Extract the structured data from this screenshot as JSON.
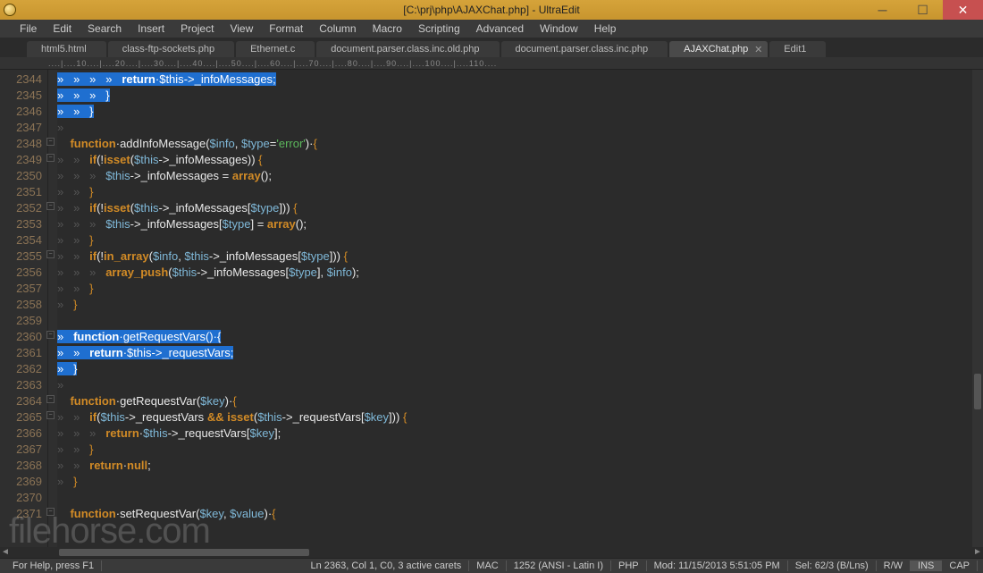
{
  "title": "[C:\\prj\\php\\AJAXChat.php] - UltraEdit",
  "menus": [
    "File",
    "Edit",
    "Search",
    "Insert",
    "Project",
    "View",
    "Format",
    "Column",
    "Macro",
    "Scripting",
    "Advanced",
    "Window",
    "Help"
  ],
  "tabs": [
    {
      "label": "html5.html",
      "active": false
    },
    {
      "label": "class-ftp-sockets.php",
      "active": false
    },
    {
      "label": "Ethernet.c",
      "active": false
    },
    {
      "label": "document.parser.class.inc.old.php",
      "active": false
    },
    {
      "label": "document.parser.class.inc.php",
      "active": false
    },
    {
      "label": "AJAXChat.php",
      "active": true
    },
    {
      "label": "Edit1",
      "active": false
    }
  ],
  "ruler": "....|....10....|....20....|....30....|....40....|....50....|....60....|....70....|....80....|....90....|....100....|....110....",
  "first_line": 2344,
  "lines": [
    {
      "sel": true,
      "seg": [
        [
          "tab",
          "»   "
        ],
        [
          "tab",
          "»   "
        ],
        [
          "tab",
          "»   "
        ],
        [
          "tab",
          "»   "
        ],
        [
          "kw",
          "return"
        ],
        [
          "op",
          "·"
        ],
        [
          "var",
          "$this"
        ],
        [
          "op",
          "->"
        ],
        [
          "fn",
          "_infoMessages"
        ],
        [
          "op",
          ";"
        ]
      ]
    },
    {
      "sel": true,
      "seg": [
        [
          "tab",
          "»   "
        ],
        [
          "tab",
          "»   "
        ],
        [
          "tab",
          "»   "
        ],
        [
          "br",
          "}"
        ]
      ]
    },
    {
      "sel": true,
      "seg": [
        [
          "tab",
          "»   "
        ],
        [
          "tab",
          "»   "
        ],
        [
          "br",
          "}"
        ]
      ]
    },
    {
      "sel": false,
      "seg": [
        [
          "tab",
          "»"
        ]
      ]
    },
    {
      "sel": false,
      "seg": [
        [
          "ws",
          "    "
        ],
        [
          "kw",
          "function"
        ],
        [
          "op",
          "·"
        ],
        [
          "fn",
          "addInfoMessage"
        ],
        [
          "op",
          "("
        ],
        [
          "var",
          "$info"
        ],
        [
          "op",
          ", "
        ],
        [
          "var",
          "$type"
        ],
        [
          "op",
          "="
        ],
        [
          "str",
          "'error'"
        ],
        [
          "op",
          ")·"
        ],
        [
          "br",
          "{"
        ]
      ]
    },
    {
      "sel": false,
      "seg": [
        [
          "tab",
          "»   »   "
        ],
        [
          "kw",
          "if"
        ],
        [
          "op",
          "(!"
        ],
        [
          "kw",
          "isset"
        ],
        [
          "op",
          "("
        ],
        [
          "var",
          "$this"
        ],
        [
          "op",
          "->"
        ],
        [
          "fn",
          "_infoMessages"
        ],
        [
          "op",
          ")) "
        ],
        [
          "br",
          "{"
        ]
      ]
    },
    {
      "sel": false,
      "seg": [
        [
          "tab",
          "»   »   »   "
        ],
        [
          "var",
          "$this"
        ],
        [
          "op",
          "->"
        ],
        [
          "fn",
          "_infoMessages"
        ],
        [
          "op",
          " = "
        ],
        [
          "kw",
          "array"
        ],
        [
          "op",
          "();"
        ]
      ]
    },
    {
      "sel": false,
      "seg": [
        [
          "tab",
          "»   »   "
        ],
        [
          "br",
          "}"
        ]
      ]
    },
    {
      "sel": false,
      "seg": [
        [
          "tab",
          "»   »   "
        ],
        [
          "kw",
          "if"
        ],
        [
          "op",
          "(!"
        ],
        [
          "kw",
          "isset"
        ],
        [
          "op",
          "("
        ],
        [
          "var",
          "$this"
        ],
        [
          "op",
          "->"
        ],
        [
          "fn",
          "_infoMessages"
        ],
        [
          "op",
          "["
        ],
        [
          "var",
          "$type"
        ],
        [
          "op",
          "])) "
        ],
        [
          "br",
          "{"
        ]
      ]
    },
    {
      "sel": false,
      "seg": [
        [
          "tab",
          "»   »   »   "
        ],
        [
          "var",
          "$this"
        ],
        [
          "op",
          "->"
        ],
        [
          "fn",
          "_infoMessages"
        ],
        [
          "op",
          "["
        ],
        [
          "var",
          "$type"
        ],
        [
          "op",
          "] = "
        ],
        [
          "kw",
          "array"
        ],
        [
          "op",
          "();"
        ]
      ]
    },
    {
      "sel": false,
      "seg": [
        [
          "tab",
          "»   »   "
        ],
        [
          "br",
          "}"
        ]
      ]
    },
    {
      "sel": false,
      "seg": [
        [
          "tab",
          "»   »   "
        ],
        [
          "kw",
          "if"
        ],
        [
          "op",
          "(!"
        ],
        [
          "kw",
          "in_array"
        ],
        [
          "op",
          "("
        ],
        [
          "var",
          "$info"
        ],
        [
          "op",
          ", "
        ],
        [
          "var",
          "$this"
        ],
        [
          "op",
          "->"
        ],
        [
          "fn",
          "_infoMessages"
        ],
        [
          "op",
          "["
        ],
        [
          "var",
          "$type"
        ],
        [
          "op",
          "])) "
        ],
        [
          "br",
          "{"
        ]
      ]
    },
    {
      "sel": false,
      "seg": [
        [
          "tab",
          "»   »   »   "
        ],
        [
          "kw",
          "array_push"
        ],
        [
          "op",
          "("
        ],
        [
          "var",
          "$this"
        ],
        [
          "op",
          "->"
        ],
        [
          "fn",
          "_infoMessages"
        ],
        [
          "op",
          "["
        ],
        [
          "var",
          "$type"
        ],
        [
          "op",
          "], "
        ],
        [
          "var",
          "$info"
        ],
        [
          "op",
          ");"
        ]
      ]
    },
    {
      "sel": false,
      "seg": [
        [
          "tab",
          "»   »   "
        ],
        [
          "br",
          "}"
        ]
      ]
    },
    {
      "sel": false,
      "seg": [
        [
          "tab",
          "»   "
        ],
        [
          "br",
          "}"
        ]
      ]
    },
    {
      "sel": false,
      "seg": [
        [
          "ws",
          " "
        ]
      ]
    },
    {
      "sel": true,
      "seg": [
        [
          "tab",
          "»   "
        ],
        [
          "kw",
          "function"
        ],
        [
          "op",
          "·"
        ],
        [
          "fn",
          "getRequestVars"
        ],
        [
          "op",
          "()·"
        ],
        [
          "br",
          "{"
        ]
      ]
    },
    {
      "sel": true,
      "seg": [
        [
          "tab",
          "»   »   "
        ],
        [
          "kw",
          "return"
        ],
        [
          "op",
          "·"
        ],
        [
          "var",
          "$this"
        ],
        [
          "op",
          "->"
        ],
        [
          "fn",
          "_requestVars"
        ],
        [
          "op",
          ";"
        ]
      ]
    },
    {
      "sel": true,
      "seg": [
        [
          "tab",
          "»   "
        ],
        [
          "br",
          "}"
        ]
      ]
    },
    {
      "sel": false,
      "seg": [
        [
          "tab",
          "»"
        ]
      ]
    },
    {
      "sel": false,
      "seg": [
        [
          "ws",
          "    "
        ],
        [
          "kw",
          "function"
        ],
        [
          "op",
          "·"
        ],
        [
          "fn",
          "getRequestVar"
        ],
        [
          "op",
          "("
        ],
        [
          "var",
          "$key"
        ],
        [
          "op",
          ")·"
        ],
        [
          "br",
          "{"
        ]
      ]
    },
    {
      "sel": false,
      "seg": [
        [
          "tab",
          "»   »   "
        ],
        [
          "kw",
          "if"
        ],
        [
          "op",
          "("
        ],
        [
          "var",
          "$this"
        ],
        [
          "op",
          "->"
        ],
        [
          "fn",
          "_requestVars"
        ],
        [
          "op",
          " "
        ],
        [
          "kw",
          "&&"
        ],
        [
          "op",
          " "
        ],
        [
          "kw",
          "isset"
        ],
        [
          "op",
          "("
        ],
        [
          "var",
          "$this"
        ],
        [
          "op",
          "->"
        ],
        [
          "fn",
          "_requestVars"
        ],
        [
          "op",
          "["
        ],
        [
          "var",
          "$key"
        ],
        [
          "op",
          "])) "
        ],
        [
          "br",
          "{"
        ]
      ]
    },
    {
      "sel": false,
      "seg": [
        [
          "tab",
          "»   »   »   "
        ],
        [
          "kw",
          "return"
        ],
        [
          "op",
          "·"
        ],
        [
          "var",
          "$this"
        ],
        [
          "op",
          "->"
        ],
        [
          "fn",
          "_requestVars"
        ],
        [
          "op",
          "["
        ],
        [
          "var",
          "$key"
        ],
        [
          "op",
          "];"
        ]
      ]
    },
    {
      "sel": false,
      "seg": [
        [
          "tab",
          "»   »   "
        ],
        [
          "br",
          "}"
        ]
      ]
    },
    {
      "sel": false,
      "seg": [
        [
          "tab",
          "»   »   "
        ],
        [
          "kw",
          "return"
        ],
        [
          "op",
          "·"
        ],
        [
          "kw",
          "null"
        ],
        [
          "op",
          ";"
        ]
      ]
    },
    {
      "sel": false,
      "seg": [
        [
          "tab",
          "»   "
        ],
        [
          "br",
          "}"
        ]
      ]
    },
    {
      "sel": false,
      "seg": [
        [
          "ws",
          " "
        ]
      ]
    },
    {
      "sel": false,
      "seg": [
        [
          "ws",
          "    "
        ],
        [
          "kw",
          "function"
        ],
        [
          "op",
          "·"
        ],
        [
          "fn",
          "setRequestVar"
        ],
        [
          "op",
          "("
        ],
        [
          "var",
          "$key"
        ],
        [
          "op",
          ", "
        ],
        [
          "var",
          "$value"
        ],
        [
          "op",
          ")·"
        ],
        [
          "br",
          "{"
        ]
      ]
    }
  ],
  "status": {
    "help": "For Help, press F1",
    "pos": "Ln 2363, Col 1, C0, 3 active carets",
    "eol": "MAC",
    "enc": "1252 (ANSI - Latin I)",
    "lang": "PHP",
    "mod": "Mod: 11/15/2013 5:51:05 PM",
    "sel": "Sel: 62/3 (B/Lns)",
    "rw": "R/W",
    "ins": "INS",
    "cap": "CAP"
  },
  "watermark": "filehorse.com"
}
